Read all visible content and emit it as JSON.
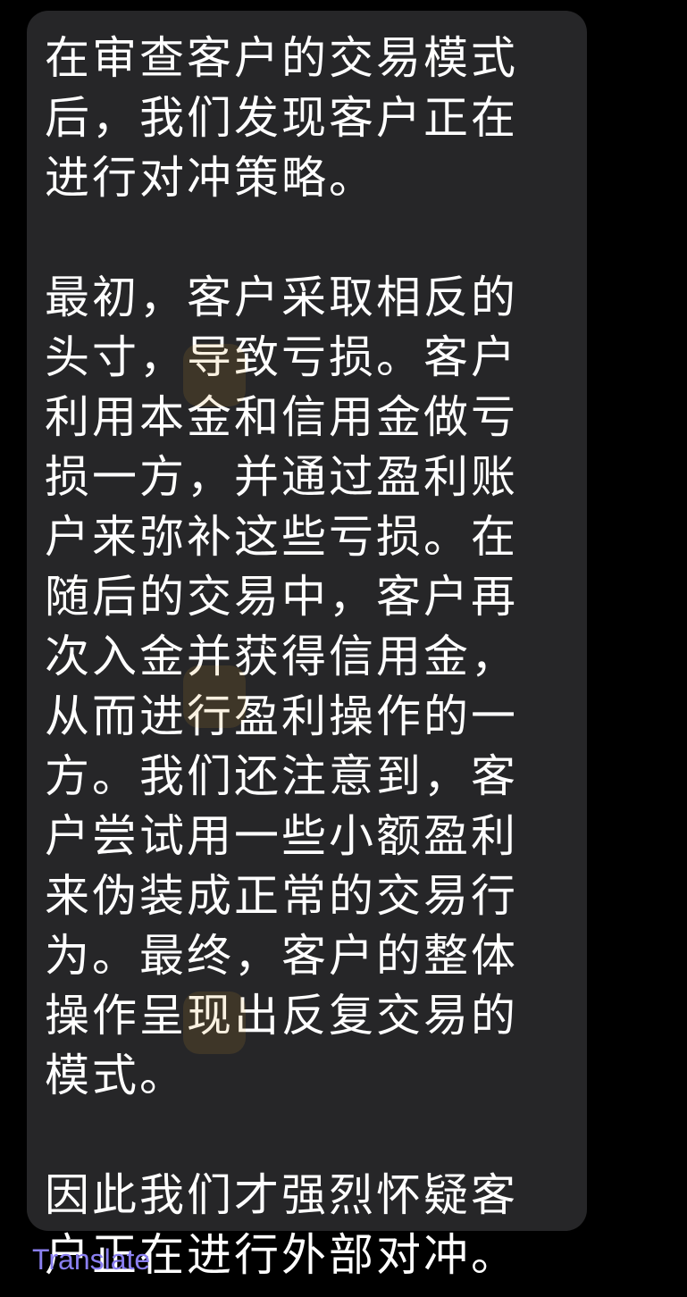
{
  "message": {
    "paragraphs": [
      "在审查客户的交易模式\n后，我们发现客户正在\n进行对冲策略。",
      "最初，客户采取相反的\n头寸，导致亏损。客户\n利用本金和信用金做亏\n损一方，并通过盈利账\n户来弥补这些亏损。在\n随后的交易中，客户再\n次入金并获得信用金，\n从而进行盈利操作的一\n方。我们还注意到，客\n户尝试用一些小额盈利\n来伪装成正常的交易行\n为。最终，客户的整体\n操作呈现出反复交易的\n模式。",
      "因此我们才强烈怀疑客\n户正在进行外部对冲。"
    ]
  },
  "translate_label": "Translate",
  "colors": {
    "background": "#000000",
    "bubble": "#262628",
    "text": "#ffffff",
    "link": "#8a7ff0"
  }
}
